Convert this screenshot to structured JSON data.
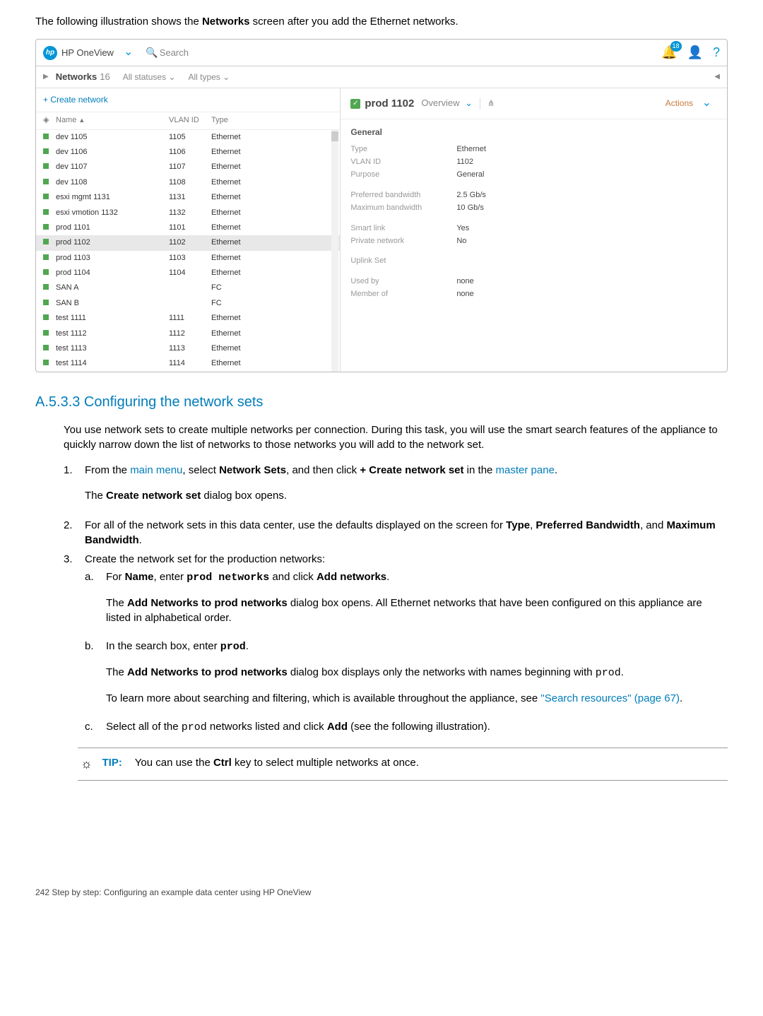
{
  "intro": "The following illustration shows the Networks screen after you add the Ethernet networks.",
  "intro_prefix": "The following illustration shows the ",
  "intro_bold": "Networks",
  "intro_suffix": " screen after you add the Ethernet networks.",
  "topbar": {
    "app": "HP OneView",
    "search": "Search",
    "badge": "18"
  },
  "subhead": {
    "title": "Networks",
    "count": "16",
    "filter1": "All statuses",
    "filter2": "All types"
  },
  "create_link": "+ Create network",
  "columns": {
    "name": "Name",
    "vlan": "VLAN ID",
    "type": "Type"
  },
  "rows": [
    {
      "name": "dev 1105",
      "vlan": "1105",
      "type": "Ethernet"
    },
    {
      "name": "dev 1106",
      "vlan": "1106",
      "type": "Ethernet"
    },
    {
      "name": "dev 1107",
      "vlan": "1107",
      "type": "Ethernet"
    },
    {
      "name": "dev 1108",
      "vlan": "1108",
      "type": "Ethernet"
    },
    {
      "name": "esxi mgmt 1131",
      "vlan": "1131",
      "type": "Ethernet"
    },
    {
      "name": "esxi vmotion 1132",
      "vlan": "1132",
      "type": "Ethernet"
    },
    {
      "name": "prod 1101",
      "vlan": "1101",
      "type": "Ethernet"
    },
    {
      "name": "prod 1102",
      "vlan": "1102",
      "type": "Ethernet",
      "selected": true
    },
    {
      "name": "prod 1103",
      "vlan": "1103",
      "type": "Ethernet"
    },
    {
      "name": "prod 1104",
      "vlan": "1104",
      "type": "Ethernet"
    },
    {
      "name": "SAN A",
      "vlan": "",
      "type": "FC"
    },
    {
      "name": "SAN B",
      "vlan": "",
      "type": "FC"
    },
    {
      "name": "test 1111",
      "vlan": "1111",
      "type": "Ethernet"
    },
    {
      "name": "test 1112",
      "vlan": "1112",
      "type": "Ethernet"
    },
    {
      "name": "test 1113",
      "vlan": "1113",
      "type": "Ethernet"
    },
    {
      "name": "test 1114",
      "vlan": "1114",
      "type": "Ethernet"
    }
  ],
  "detail": {
    "title": "prod 1102",
    "overview": "Overview",
    "actions": "Actions",
    "general": "General",
    "kv": [
      {
        "k": "Type",
        "v": "Ethernet"
      },
      {
        "k": "VLAN ID",
        "v": "1102"
      },
      {
        "k": "Purpose",
        "v": "General"
      },
      {
        "gap": true
      },
      {
        "k": "Preferred bandwidth",
        "v": "2.5 Gb/s"
      },
      {
        "k": "Maximum bandwidth",
        "v": "10 Gb/s"
      },
      {
        "gap": true
      },
      {
        "k": "Smart link",
        "v": "Yes"
      },
      {
        "k": "Private network",
        "v": "No"
      },
      {
        "gap": true
      },
      {
        "k": "Uplink Set",
        "v": ""
      },
      {
        "gap": true
      },
      {
        "k": "Used by",
        "v": "none"
      },
      {
        "k": "Member of",
        "v": "none"
      }
    ]
  },
  "doc": {
    "heading": "A.5.3.3 Configuring the network sets",
    "para1": "You use network sets to create multiple networks per connection. During this task, you will use the smart search features of the appliance to quickly narrow down the list of networks to those networks you will add to the network set.",
    "step1_a": "From the ",
    "step1_link1": "main menu",
    "step1_b": ", select ",
    "step1_bold1": "Network Sets",
    "step1_c": ", and then click ",
    "step1_bold2": "+ Create network set",
    "step1_d": " in the ",
    "step1_link2": "master pane",
    "step1_e": ".",
    "step1_sub_a": "The ",
    "step1_sub_b": "Create network set",
    "step1_sub_c": " dialog box opens.",
    "step2_a": "For all of the network sets in this data center, use the defaults displayed on the screen for ",
    "step2_b1": "Type",
    "step2_comma1": ", ",
    "step2_b2": "Preferred Bandwidth",
    "step2_comma2": ", and ",
    "step2_b3": "Maximum Bandwidth",
    "step2_c": ".",
    "step3": "Create the network set for the production networks:",
    "step3a_pre": "For ",
    "step3a_name": "Name",
    "step3a_mid": ", enter ",
    "step3a_mono": "prod networks",
    "step3a_mid2": " and click ",
    "step3a_add": "Add networks",
    "step3a_end": ".",
    "step3a_p2_a": "The ",
    "step3a_p2_b": "Add Networks to prod networks",
    "step3a_p2_c": " dialog box opens. All Ethernet networks that have been configured on this appliance are listed in alphabetical order.",
    "step3b_a": "In the search box, enter ",
    "step3b_mono": "prod",
    "step3b_b": ".",
    "step3b_p2_a": "The ",
    "step3b_p2_b": "Add Networks to prod networks",
    "step3b_p2_c": " dialog box displays only the networks with names beginning with ",
    "step3b_p2_mono": "prod",
    "step3b_p2_d": ".",
    "step3b_p3_a": "To learn more about searching and filtering, which is available throughout the appliance, see ",
    "step3b_p3_link": "\"Search resources\" (page 67)",
    "step3b_p3_b": ".",
    "step3c_a": "Select all of the ",
    "step3c_mono": "prod",
    "step3c_b": " networks listed and click ",
    "step3c_bold": "Add",
    "step3c_c": " (see the following illustration).",
    "tip_label": "TIP:",
    "tip_a": "You can use the ",
    "tip_b": "Ctrl",
    "tip_c": " key to select multiple networks at once.",
    "footer": "242   Step by step: Configuring an example data center using HP OneView"
  }
}
